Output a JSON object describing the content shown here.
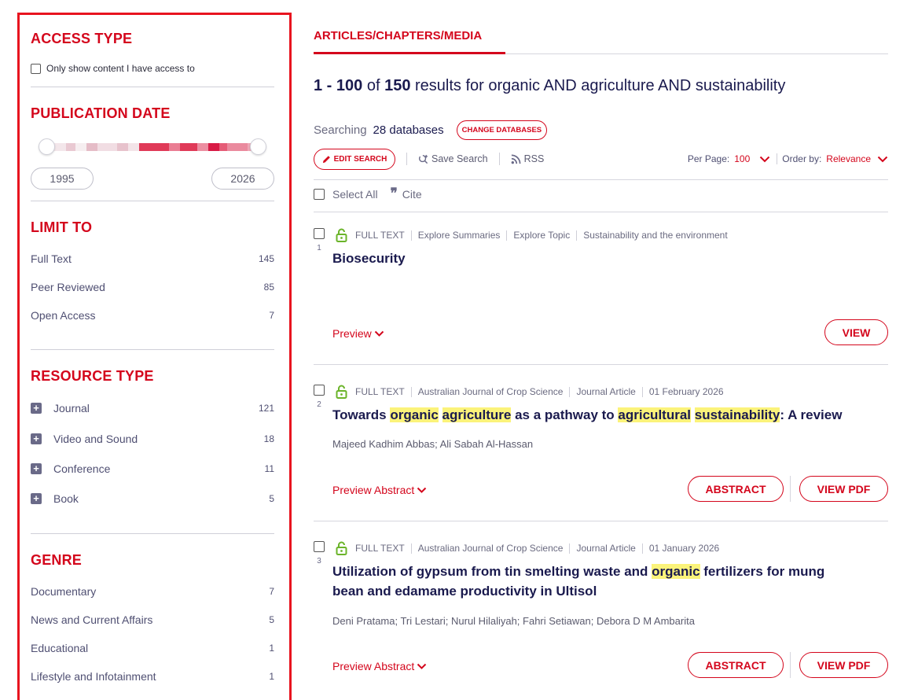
{
  "sidebar": {
    "access_type": {
      "heading": "ACCESS TYPE",
      "checkbox_label": "Only show content I have access to"
    },
    "publication_date": {
      "heading": "PUBLICATION DATE",
      "from": "1995",
      "to": "2026"
    },
    "limit_to": {
      "heading": "LIMIT TO",
      "items": [
        {
          "label": "Full Text",
          "count": "145"
        },
        {
          "label": "Peer Reviewed",
          "count": "85"
        },
        {
          "label": "Open Access",
          "count": "7"
        }
      ]
    },
    "resource_type": {
      "heading": "RESOURCE TYPE",
      "items": [
        {
          "label": "Journal",
          "count": "121"
        },
        {
          "label": "Video and Sound",
          "count": "18"
        },
        {
          "label": "Conference",
          "count": "11"
        },
        {
          "label": "Book",
          "count": "5"
        }
      ]
    },
    "genre": {
      "heading": "GENRE",
      "items": [
        {
          "label": "Documentary",
          "count": "7"
        },
        {
          "label": "News and Current Affairs",
          "count": "5"
        },
        {
          "label": "Educational",
          "count": "1"
        },
        {
          "label": "Lifestyle and Infotainment",
          "count": "1"
        }
      ]
    }
  },
  "main": {
    "tab_label": "ARTICLES/CHAPTERS/MEDIA",
    "results": {
      "range": "1 - 100",
      "of": "of",
      "total": "150",
      "results_for": "results for",
      "query": "organic AND agriculture AND sustainability"
    },
    "searching_label": "Searching",
    "databases": "28 databases",
    "change_databases": "CHANGE DATABASES",
    "edit_search": "EDIT SEARCH",
    "save_search": "Save Search",
    "rss": "RSS",
    "per_page_label": "Per Page:",
    "per_page_value": "100",
    "order_by_label": "Order by:",
    "order_by_value": "Relevance",
    "select_all": "Select All",
    "cite": "Cite",
    "items": [
      {
        "num": "1",
        "full_text": "FULL TEXT",
        "meta": [
          "Explore Summaries",
          "Explore Topic",
          "Sustainability and the environment"
        ],
        "title": "Biosecurity",
        "preview": "Preview",
        "view": "VIEW"
      },
      {
        "num": "2",
        "full_text": "FULL TEXT",
        "meta": [
          "Australian Journal of Crop Science",
          "Journal Article",
          "01 February 2026"
        ],
        "title_parts": [
          "Towards ",
          "organic",
          " ",
          "agriculture",
          " as a pathway to ",
          "agricultural",
          " ",
          "sustainability",
          ": A review"
        ],
        "authors": "Majeed Kadhim Abbas; Ali Sabah Al-Hassan",
        "preview": "Preview Abstract",
        "abstract": "ABSTRACT",
        "view_pdf": "VIEW PDF"
      },
      {
        "num": "3",
        "full_text": "FULL TEXT",
        "meta": [
          "Australian Journal of Crop Science",
          "Journal Article",
          "01 January 2026"
        ],
        "title_line1_parts": [
          "Utilization of gypsum from tin smelting waste and ",
          "organic",
          " fertilizers for mung"
        ],
        "title_line2": "bean and edamame productivity in Ultisol",
        "authors": "Deni Pratama; Tri Lestari; Nurul Hilaliyah; Fahri Setiawan; Debora D M Ambarita",
        "preview": "Preview Abstract",
        "abstract": "ABSTRACT",
        "view_pdf": "VIEW PDF"
      }
    ]
  },
  "colors": {
    "accent": "#d4061c",
    "navy": "#1a1a4e",
    "highlight": "#fbf37a",
    "lock": "#6bb42a",
    "sidebar_border": "#e8141f"
  }
}
